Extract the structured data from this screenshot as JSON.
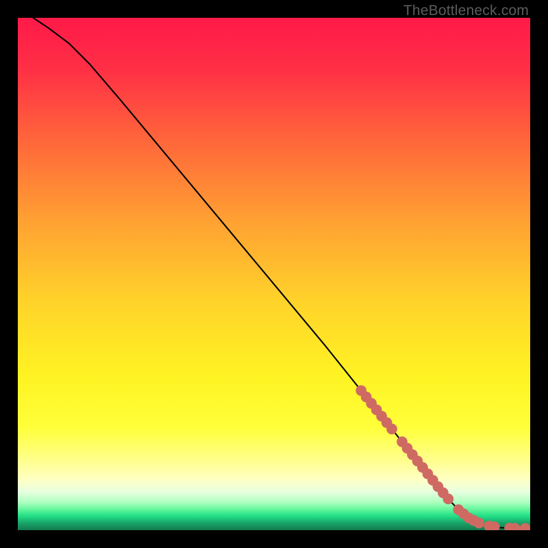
{
  "watermark": "TheBottleneck.com",
  "colors": {
    "line": "#000000",
    "marker_fill": "#cf6a63",
    "marker_stroke": "#cf6a63",
    "bg_black": "#000000"
  },
  "chart_data": {
    "type": "line",
    "title": "",
    "xlabel": "",
    "ylabel": "",
    "xlim": [
      0,
      100
    ],
    "ylim": [
      0,
      100
    ],
    "grid": false,
    "legend": false,
    "series": [
      {
        "name": "curve",
        "x": [
          3,
          6,
          10,
          14,
          20,
          30,
          40,
          50,
          60,
          68,
          72,
          76,
          80,
          82,
          84,
          86,
          88,
          90,
          92,
          94,
          96,
          98,
          100
        ],
        "y": [
          100,
          98,
          95,
          91,
          84,
          72,
          60,
          48,
          36,
          26,
          21,
          16,
          11,
          8.5,
          6.1,
          4.0,
          2.4,
          1.4,
          0.8,
          0.5,
          0.4,
          0.35,
          0.3
        ]
      }
    ],
    "markers_along_curve": {
      "name": "highlight-dots",
      "x": [
        67,
        68,
        69,
        70,
        71,
        72,
        73,
        75,
        76,
        77,
        78,
        79,
        80,
        81,
        82,
        83,
        84,
        86,
        87,
        88,
        89,
        90,
        92,
        93,
        96,
        97,
        99
      ],
      "radius": 1.0
    },
    "gradient_stops": [
      {
        "offset": 0.0,
        "color": "#ff1a49"
      },
      {
        "offset": 0.1,
        "color": "#ff2f45"
      },
      {
        "offset": 0.25,
        "color": "#ff6a3a"
      },
      {
        "offset": 0.4,
        "color": "#ffa232"
      },
      {
        "offset": 0.55,
        "color": "#ffd22a"
      },
      {
        "offset": 0.7,
        "color": "#fff323"
      },
      {
        "offset": 0.8,
        "color": "#ffff3a"
      },
      {
        "offset": 0.86,
        "color": "#ffff88"
      },
      {
        "offset": 0.9,
        "color": "#ffffc2"
      },
      {
        "offset": 0.925,
        "color": "#e8ffe0"
      },
      {
        "offset": 0.945,
        "color": "#b0ffc0"
      },
      {
        "offset": 0.958,
        "color": "#6cf7a0"
      },
      {
        "offset": 0.968,
        "color": "#35e78d"
      },
      {
        "offset": 0.975,
        "color": "#1fd582"
      },
      {
        "offset": 0.985,
        "color": "#1aa76a"
      },
      {
        "offset": 1.0,
        "color": "#147a4e"
      }
    ]
  }
}
